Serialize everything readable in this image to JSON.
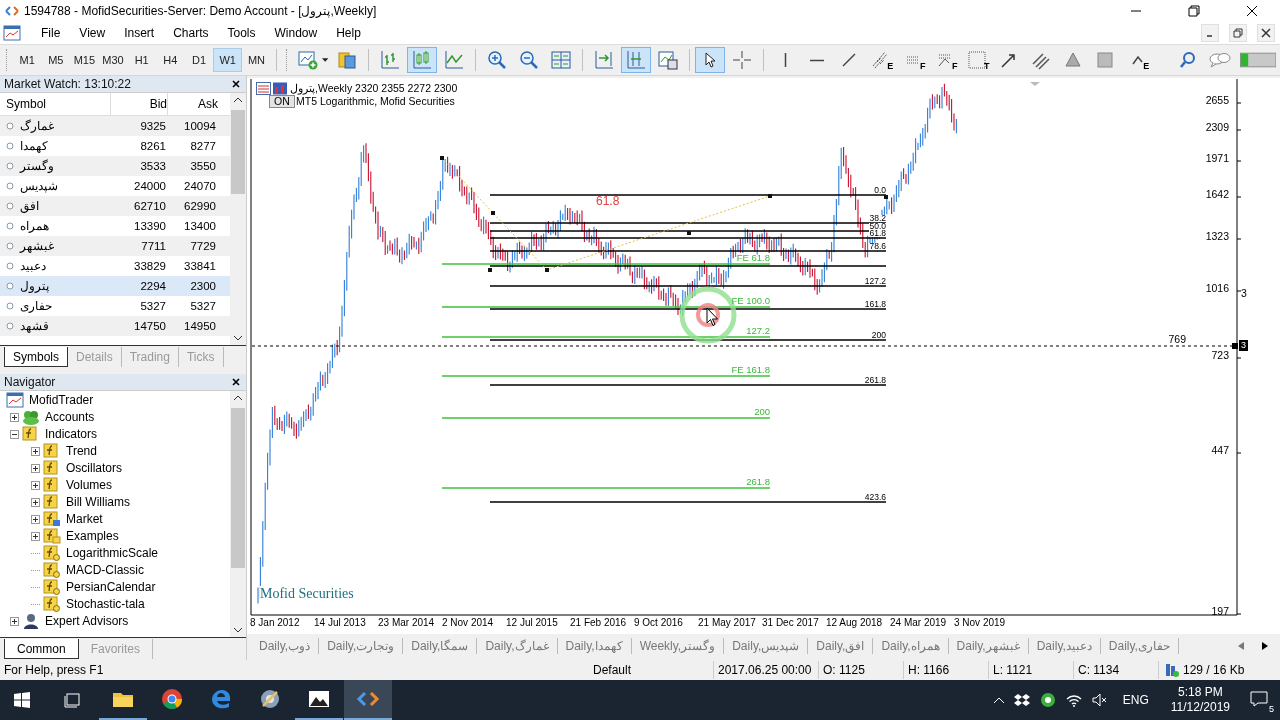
{
  "window": {
    "title": "1594788 - MofidSecurities-Server: Demo Account - [پترول,Weekly]"
  },
  "menu": [
    "File",
    "View",
    "Insert",
    "Charts",
    "Tools",
    "Window",
    "Help"
  ],
  "timeframes": [
    {
      "label": "M1",
      "selected": false
    },
    {
      "label": "M5",
      "selected": false
    },
    {
      "label": "M15",
      "selected": false
    },
    {
      "label": "M30",
      "selected": false
    },
    {
      "label": "H1",
      "selected": false
    },
    {
      "label": "H4",
      "selected": false
    },
    {
      "label": "D1",
      "selected": false
    },
    {
      "label": "W1",
      "selected": true
    },
    {
      "label": "MN",
      "selected": false
    }
  ],
  "toolbar": [
    {
      "kind": "new-chart",
      "selected": false
    },
    {
      "kind": "caret",
      "selected": false
    },
    {
      "kind": "profiles",
      "selected": false
    },
    {
      "kind": "sep"
    },
    {
      "kind": "bar-chart",
      "selected": false
    },
    {
      "kind": "candle-chart",
      "selected": true
    },
    {
      "kind": "line-chart",
      "selected": false
    },
    {
      "kind": "sep"
    },
    {
      "kind": "zoom-in",
      "selected": false
    },
    {
      "kind": "zoom-out",
      "selected": false
    },
    {
      "kind": "tile",
      "selected": false
    },
    {
      "kind": "sep"
    },
    {
      "kind": "chart-shift",
      "selected": false
    },
    {
      "kind": "autoscroll",
      "selected": true
    },
    {
      "kind": "templates",
      "selected": false
    },
    {
      "kind": "sep"
    },
    {
      "kind": "cursor",
      "selected": true
    },
    {
      "kind": "crosshair",
      "selected": false
    },
    {
      "kind": "sep"
    },
    {
      "kind": "vline",
      "selected": false
    },
    {
      "kind": "hline",
      "selected": false
    },
    {
      "kind": "trendline",
      "selected": false
    },
    {
      "kind": "fib-fan",
      "selected": false,
      "badge": "E"
    },
    {
      "kind": "fib-grid",
      "selected": false,
      "badge": "F"
    },
    {
      "kind": "fib-expansion",
      "selected": false,
      "badge": "F"
    },
    {
      "kind": "text-tool",
      "selected": false,
      "badge": "T"
    },
    {
      "kind": "arrow",
      "selected": false
    },
    {
      "kind": "channel",
      "selected": false
    },
    {
      "kind": "triangle",
      "selected": false
    },
    {
      "kind": "rectangle",
      "selected": false
    },
    {
      "kind": "elliott",
      "selected": false,
      "badge": "E"
    },
    {
      "kind": "gap"
    },
    {
      "kind": "search",
      "selected": false
    },
    {
      "kind": "chat",
      "selected": false
    },
    {
      "kind": "meter",
      "selected": false
    }
  ],
  "market_watch": {
    "title": "Market Watch: 13:10:22",
    "columns": [
      "Symbol",
      "Bid",
      "Ask"
    ],
    "rows": [
      {
        "symbol": "غمارگ",
        "bid": "9325",
        "ask": "10094",
        "selected": false
      },
      {
        "symbol": "کهمدا",
        "bid": "8261",
        "ask": "8277",
        "selected": false
      },
      {
        "symbol": "وگستر",
        "bid": "3533",
        "ask": "3550",
        "selected": false
      },
      {
        "symbol": "شپدیس",
        "bid": "24000",
        "ask": "24070",
        "selected": false
      },
      {
        "symbol": "افق",
        "bid": "62710",
        "ask": "62990",
        "selected": false
      },
      {
        "symbol": "همراه",
        "bid": "13390",
        "ask": "13400",
        "selected": false
      },
      {
        "symbol": "غبشهر",
        "bid": "7711",
        "ask": "7729",
        "selected": false
      },
      {
        "symbol": "دعبید",
        "bid": "33829",
        "ask": "33841",
        "selected": false
      },
      {
        "symbol": "پترول",
        "bid": "2294",
        "ask": "2300",
        "selected": true
      },
      {
        "symbol": "حفاری",
        "bid": "5327",
        "ask": "5327",
        "selected": false
      },
      {
        "symbol": "قشهد",
        "bid": "14750",
        "ask": "14950",
        "selected": false
      }
    ]
  },
  "market_watch_tabs": [
    {
      "label": "Symbols",
      "selected": true
    },
    {
      "label": "Details",
      "selected": false
    },
    {
      "label": "Trading",
      "selected": false
    },
    {
      "label": "Ticks",
      "selected": false
    }
  ],
  "navigator": {
    "title": "Navigator",
    "root": {
      "label": "MofidTrader",
      "kind": "terminal",
      "children": [
        {
          "label": "Accounts",
          "kind": "accounts",
          "expanded": false
        },
        {
          "label": "Indicators",
          "kind": "folder",
          "expanded": true,
          "children": [
            {
              "label": "Trend",
              "kind": "folder",
              "expanded": false
            },
            {
              "label": "Oscillators",
              "kind": "folder",
              "expanded": false
            },
            {
              "label": "Volumes",
              "kind": "folder",
              "expanded": false
            },
            {
              "label": "Bill Williams",
              "kind": "folder",
              "expanded": false
            },
            {
              "label": "Market",
              "kind": "market",
              "expanded": false
            },
            {
              "label": "Examples",
              "kind": "examples",
              "expanded": false
            },
            {
              "label": "LogarithmicScale",
              "kind": "custom"
            },
            {
              "label": "MACD-Classic",
              "kind": "custom"
            },
            {
              "label": "PersianCalendar",
              "kind": "custom"
            },
            {
              "label": "Stochastic-tala",
              "kind": "custom"
            }
          ]
        },
        {
          "label": "Expert Advisors",
          "kind": "experts",
          "expanded": false
        }
      ]
    }
  },
  "navigator_tabs": [
    {
      "label": "Common",
      "selected": true
    },
    {
      "label": "Favorites",
      "selected": false
    }
  ],
  "chart": {
    "symbol_line": "پترول,Weekly  2320 2355 2272 2300",
    "toggle": "ON",
    "indicator": "MT5 Logarithmic, Mofid Securities",
    "price_axis": [
      "2655",
      "2309",
      "1971",
      "1642",
      "1323",
      "1016",
      "723",
      "447",
      "197"
    ],
    "time_axis": [
      "8 Jan 2012",
      "14 Jul 2013",
      "23 Mar 2014",
      "2 Nov 2014",
      "12 Jul 2015",
      "21 Feb 2016",
      "9 Oct 2016",
      "21 May 2017",
      "31 Dec 2017",
      "12 Aug 2018",
      "24 Mar 2019",
      "3 Nov 2019"
    ],
    "retracement_levels": [
      "0.0",
      "38.2",
      "50.0",
      "61.8",
      "78.6",
      "127.2",
      "161.8",
      "200",
      "261.8",
      "423.6"
    ],
    "expansion_levels": [
      "FE 61.8",
      "FE 100.0",
      "127.2",
      "FE 161.8",
      "200",
      "261.8"
    ],
    "fibo_label": "61.8",
    "line_price": "769",
    "price_tag": "3",
    "axis_note": "3",
    "brand": "Mofid Securities"
  },
  "chart_tabs": [
    "Daily,ذوب",
    "Daily,وتجارت",
    "Daily,سمگا",
    "Daily,غمارگ",
    "Daily,کهمدا",
    "Weekly,وگستر",
    "Daily,شپدیس",
    "Daily,افق",
    "Daily,همراه",
    "Daily,غبشهر",
    "Daily,دعبید",
    "Daily,حفاری"
  ],
  "status_bar": {
    "help": "For Help, press F1",
    "profile": "Default",
    "datetime": "2017.06.25 00:00",
    "open": "O: 1125",
    "high": "H: 1166",
    "low": "L: 1121",
    "close": "C: 1134",
    "traffic": "129 / 16 Kb"
  },
  "taskbar": {
    "apps": [
      {
        "kind": "explorer",
        "running": true,
        "active": false
      },
      {
        "kind": "chrome",
        "running": false,
        "active": false
      },
      {
        "kind": "edge",
        "running": false,
        "active": false
      },
      {
        "kind": "tool",
        "running": false,
        "active": false
      },
      {
        "kind": "photos",
        "running": true,
        "active": false
      },
      {
        "kind": "code",
        "running": true,
        "active": true
      }
    ],
    "language": "ENG",
    "time": "5:18 PM",
    "date": "11/12/2019",
    "notifications": "5"
  }
}
